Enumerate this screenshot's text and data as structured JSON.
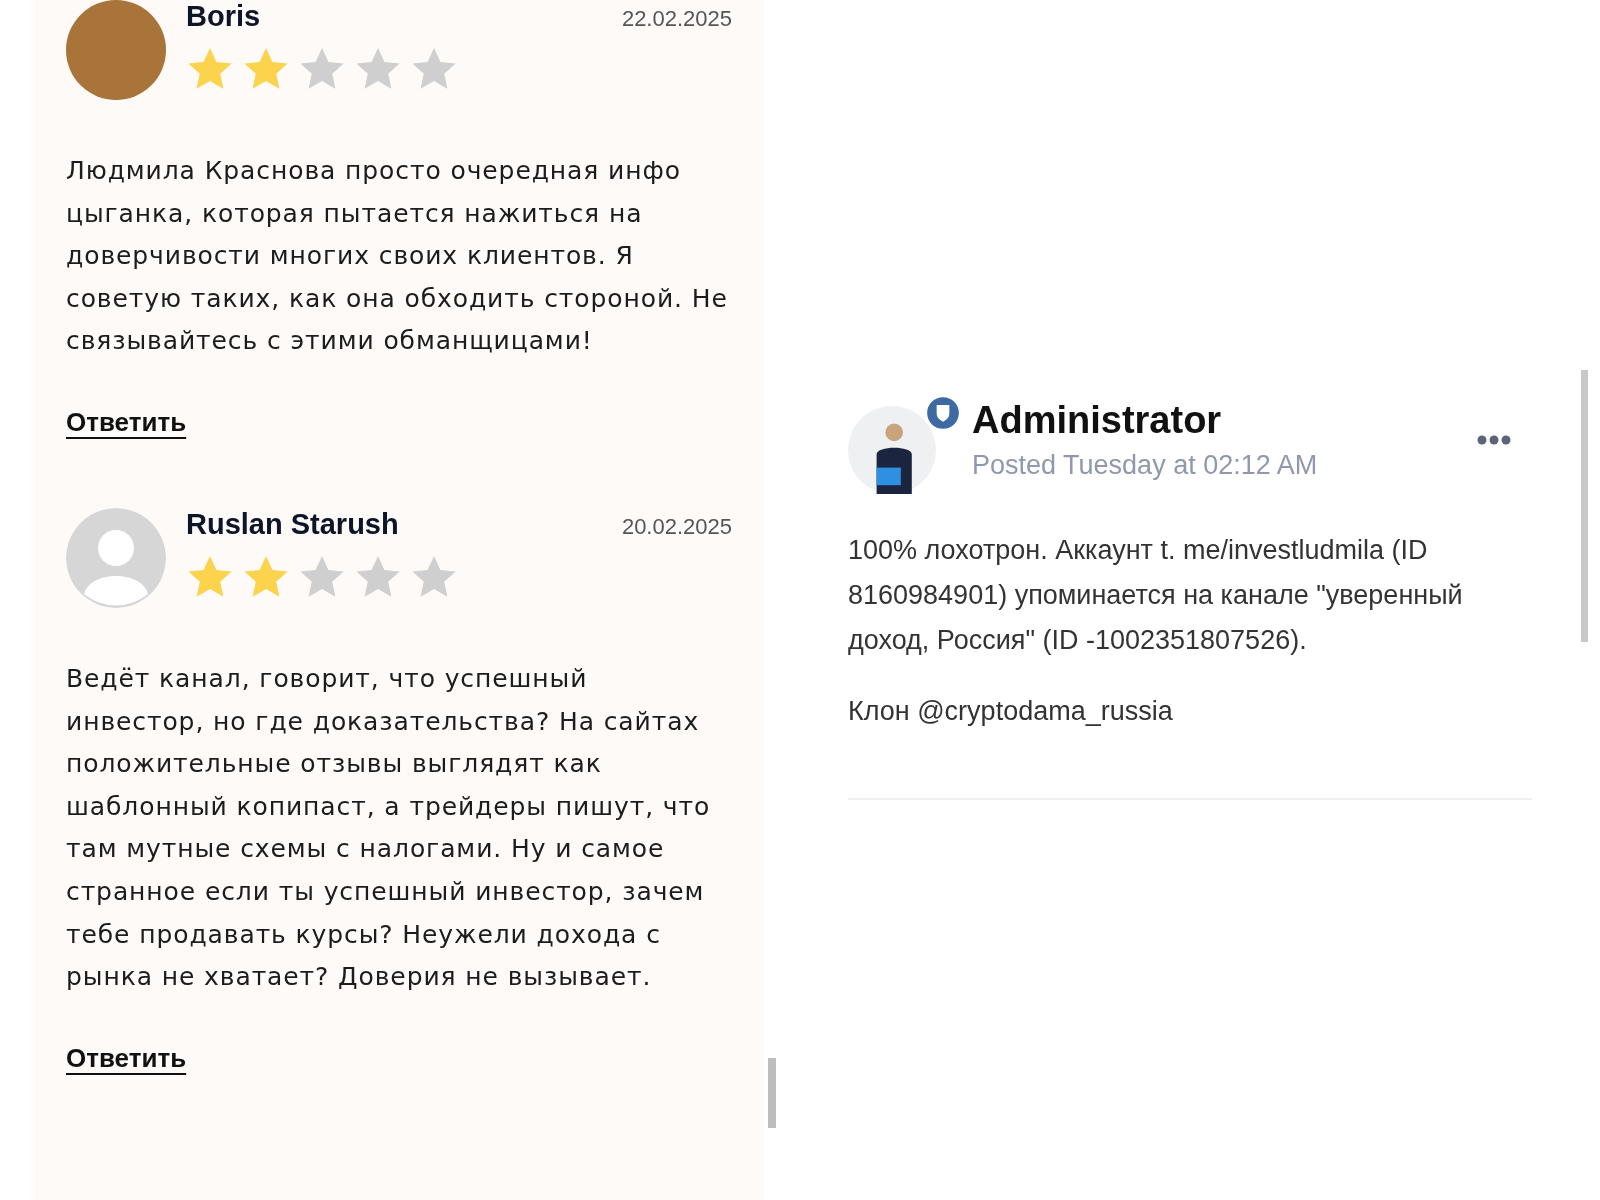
{
  "reviews": [
    {
      "author": "Boris",
      "date": "22.02.2025",
      "kind": "photo",
      "stars": 2,
      "text": "Людмила Краснова просто очередная инфо цыганка, которая пытается нажиться на доверчивости многих своих клиентов. Я советую таких, как она обходить стороной. Не связывайтесь с этими обманщицами!",
      "reply": "Ответить"
    },
    {
      "author": "Ruslan Starush",
      "date": "20.02.2025",
      "kind": "silhouette",
      "stars": 2,
      "text": "Ведёт канал, говорит, что успешный инвестор, но где доказательства? На сайтах положительные отзывы выглядят как шаблонный копипаст, а трейдеры пишут, что там мутные схемы с налогами. Ну и самое странное если ты успешный инвестор, зачем тебе продавать курсы? Неужели дохода с рынка не хватает? Доверия не вызывает.",
      "reply": "Ответить"
    }
  ],
  "post": {
    "author": "Administrator",
    "badge": true,
    "posted": "Posted Tuesday at 02:12 AM",
    "paragraphs": [
      "100% лохотрон. Аккаунт t. me/investludmila (ID 8160984901) упоминается на канале \"уверенный доход, Россия\" (ID -1002351807526).",
      "Клон @cryptodama_russia"
    ]
  }
}
